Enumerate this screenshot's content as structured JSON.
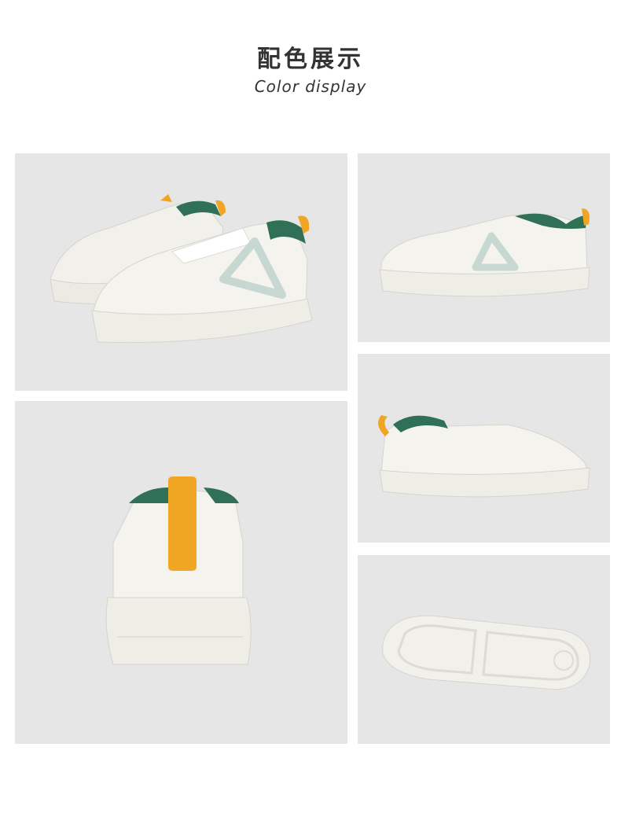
{
  "header": {
    "title_zh": "配色展示",
    "title_en": "Color display"
  },
  "palette": {
    "background": "#e7e6e6",
    "shoe_white": "#f1f0ea",
    "sole": "#ebeae3",
    "accent_green": "#2f7056",
    "pull_tab_yellow": "#f0a623",
    "logo_mint": "#c7d8d3"
  },
  "photos": [
    {
      "name": "pair-three-quarter-view"
    },
    {
      "name": "outer-side-view"
    },
    {
      "name": "heel-back-view"
    },
    {
      "name": "inner-side-view"
    },
    {
      "name": "outsole-bottom-view"
    }
  ]
}
